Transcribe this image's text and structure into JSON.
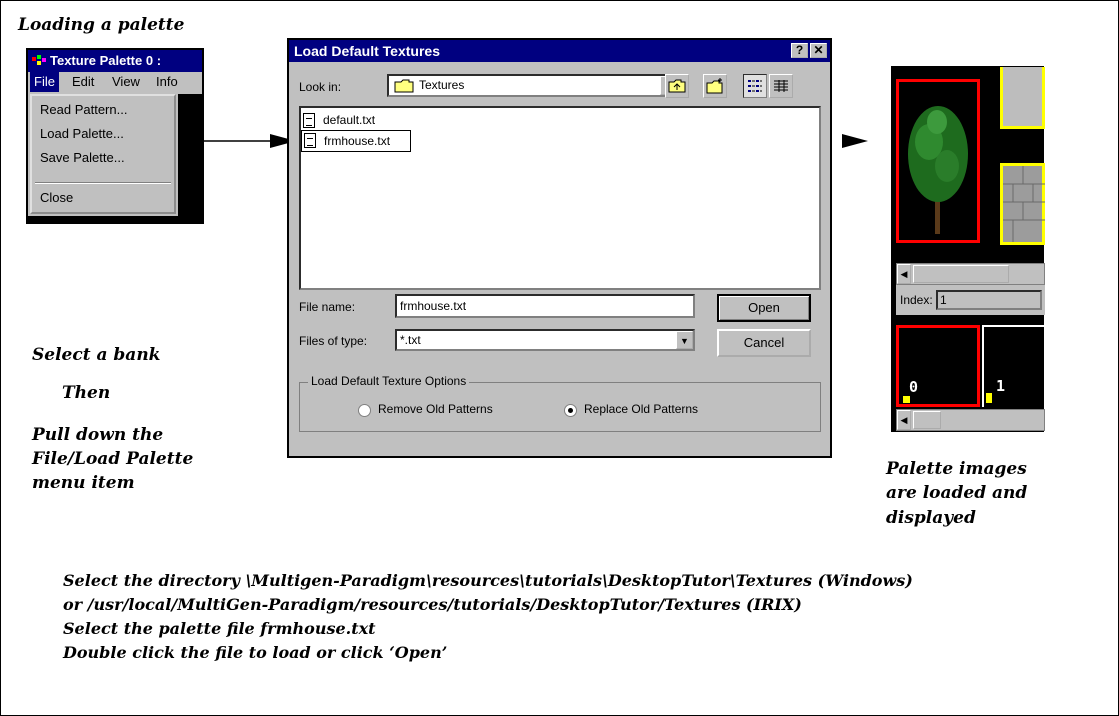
{
  "captions": {
    "loading": "Loading a palette",
    "select_bank": "Select a bank",
    "then": "Then",
    "pull_down": [
      "Pull down the",
      "File/Load Palette",
      "menu item"
    ],
    "palette_loaded": [
      "Palette images",
      "are loaded and",
      "displayed"
    ],
    "instructions": [
      "Select the directory \\Multigen-Paradigm\\resources\\tutorials\\DesktopTutor\\Textures (Windows)",
      "or /usr/local/MultiGen-Paradigm/resources/tutorials/DesktopTutor/Textures (IRIX)",
      "Select the palette file frmhouse.txt",
      "Double click the file to load or click ‘Open’"
    ]
  },
  "texture_palette": {
    "title": "Texture Palette 0 :",
    "menubar": [
      "File",
      "Edit",
      "View",
      "Info"
    ],
    "menu_items": [
      "Read Pattern...",
      "Load Palette...",
      "Save Palette...",
      "Close"
    ]
  },
  "dialog": {
    "title": "Load Default Textures",
    "help_button": "?",
    "close_button": "✕",
    "look_in_label": "Look in:",
    "look_in_value": "Textures",
    "files": [
      "default.txt",
      "frmhouse.txt"
    ],
    "selected_file_index": 1,
    "file_name_label": "File name:",
    "file_name_value": "frmhouse.txt",
    "files_of_type_label": "Files of type:",
    "files_of_type_value": "*.txt",
    "open_button": "Open",
    "cancel_button": "Cancel",
    "options_group_label": "Load Default Texture Options",
    "radio_remove": "Remove Old Patterns",
    "radio_replace": "Replace Old Patterns",
    "selected_option": "Replace Old Patterns"
  },
  "palette_view": {
    "index_label": "Index:",
    "index_value": "1",
    "bank_numbers": [
      "0",
      "1"
    ]
  },
  "colors": {
    "title_bar": "#000080",
    "window_face": "#c0c0c0",
    "selection_red": "#ff0000",
    "selection_yellow": "#ffff00"
  }
}
